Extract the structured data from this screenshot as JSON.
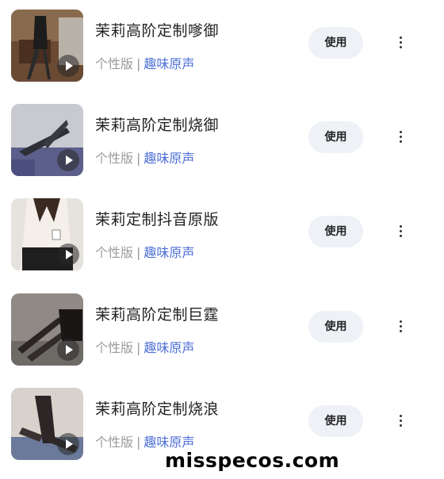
{
  "items": [
    {
      "title": "茉莉高阶定制嗲御",
      "edition": "个性版",
      "separator": "|",
      "tag": "趣味原声",
      "action_label": "使用"
    },
    {
      "title": "茉莉高阶定制烧御",
      "edition": "个性版",
      "separator": "|",
      "tag": "趣味原声",
      "action_label": "使用"
    },
    {
      "title": "茉莉定制抖音原版",
      "edition": "个性版",
      "separator": "|",
      "tag": "趣味原声",
      "action_label": "使用"
    },
    {
      "title": "茉莉高阶定制巨霆",
      "edition": "个性版",
      "separator": "|",
      "tag": "趣味原声",
      "action_label": "使用"
    },
    {
      "title": "茉莉高阶定制烧浪",
      "edition": "个性版",
      "separator": "|",
      "tag": "趣味原声",
      "action_label": "使用"
    }
  ],
  "watermark": "misspecos.com",
  "colors": {
    "tag_blue": "#4d6fd6",
    "button_bg": "#eef1f5",
    "muted_text": "#9a9a9a"
  },
  "icons": {
    "play": "play-icon",
    "more": "more-vertical-icon"
  }
}
